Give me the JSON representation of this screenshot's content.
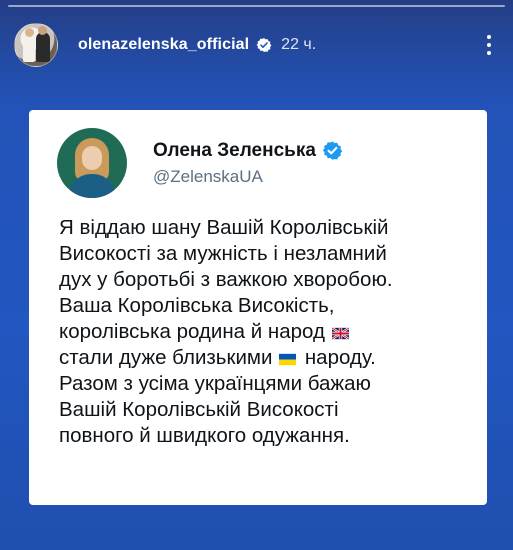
{
  "story": {
    "username": "olenazelenska_official",
    "time_ago": "22 ч."
  },
  "tweet": {
    "display_name": "Олена Зеленська",
    "handle": "@ZelenskaUA",
    "lines": [
      {
        "text": "Я віддаю шану Вашій Королівській"
      },
      {
        "text": "Високості за мужність і незламний"
      },
      {
        "text": "дух у боротьбі з важкою хворобою."
      },
      {
        "text": "Ваша Королівська Високість,"
      },
      {
        "before": "королівська родина й народ",
        "flag": "uk-flag-icon"
      },
      {
        "before": "стали дуже близькими",
        "flag": "ukraine-flag-icon",
        "after": "народу."
      },
      {
        "text": "Разом з усіма українцями бажаю"
      },
      {
        "text": "Вашій Королівській Високості"
      },
      {
        "text": "повного й швидкого одужання."
      }
    ]
  },
  "icons": {
    "verified": "verified-badge-icon",
    "menu": "more-vertical-icon"
  },
  "colors": {
    "background": "#2256c0",
    "verified_blue": "#1d9bf0",
    "text": "#0f1419",
    "muted": "#5b7083"
  }
}
